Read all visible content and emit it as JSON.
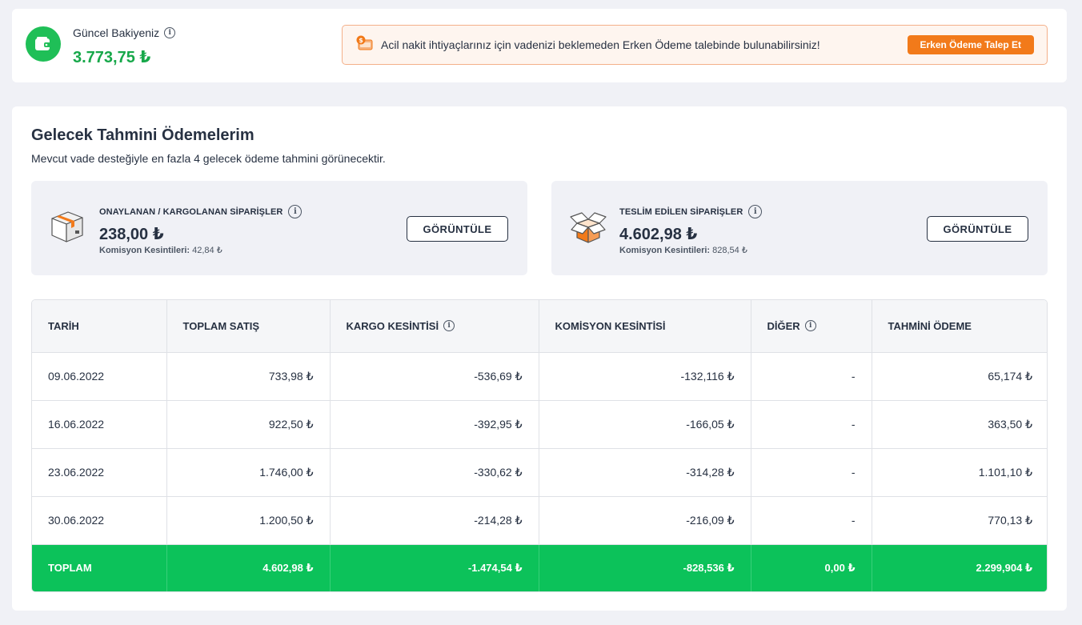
{
  "balance": {
    "label": "Güncel Bakiyeniz",
    "value": "3.773,75 ₺",
    "icon": "wallet-icon"
  },
  "alert": {
    "text": "Acil nakit ihtiyaçlarınız için vadenizi beklemeden Erken Ödeme talebinde bulunabilirsiniz!",
    "button_label": "Erken Ödeme Talep Et",
    "icon": "money-icon"
  },
  "section": {
    "title": "Gelecek Tahmini Ödemelerim",
    "subtitle": "Mevcut vade desteğiyle en fazla 4 gelecek ödeme tahmini görünecektir."
  },
  "summaries": [
    {
      "label": "ONAYLANAN / KARGOLANAN SİPARİŞLER",
      "amount": "238,00 ₺",
      "commission_label": "Komisyon Kesintileri:",
      "commission_value": "42,84 ₺",
      "button_label": "GÖRÜNTÜLE",
      "icon": "package-icon"
    },
    {
      "label": "TESLİM EDİLEN SİPARİŞLER",
      "amount": "4.602,98 ₺",
      "commission_label": "Komisyon Kesintileri:",
      "commission_value": "828,54 ₺",
      "button_label": "GÖRÜNTÜLE",
      "icon": "open-box-icon"
    }
  ],
  "table": {
    "headers": [
      "TARİH",
      "TOPLAM SATIŞ",
      "KARGO KESİNTİSİ",
      "KOMİSYON KESİNTİSİ",
      "DİĞER",
      "TAHMİNİ ÖDEME"
    ],
    "rows": [
      [
        "09.06.2022",
        "733,98 ₺",
        "-536,69 ₺",
        "-132,116 ₺",
        "-",
        "65,174 ₺"
      ],
      [
        "16.06.2022",
        "922,50 ₺",
        "-392,95 ₺",
        "-166,05 ₺",
        "-",
        "363,50 ₺"
      ],
      [
        "23.06.2022",
        "1.746,00 ₺",
        "-330,62 ₺",
        "-314,28 ₺",
        "-",
        "1.101,10 ₺"
      ],
      [
        "30.06.2022",
        "1.200,50 ₺",
        "-214,28 ₺",
        "-216,09 ₺",
        "-",
        "770,13 ₺"
      ]
    ],
    "total": [
      "TOPLAM",
      "4.602,98 ₺",
      "-1.474,54 ₺",
      "-828,536 ₺",
      "0,00 ₺",
      "2.299,904 ₺"
    ]
  },
  "colors": {
    "brand_green": "#1fbf57",
    "total_row_green": "#0cc25a",
    "accent_orange": "#f27a1a",
    "alert_bg": "#fef5ef"
  }
}
